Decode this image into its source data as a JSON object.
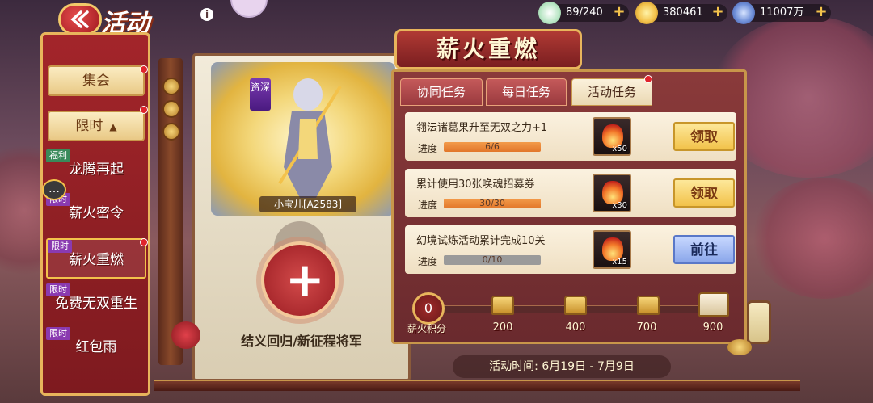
{
  "header": {
    "title": "活动",
    "info_glyph": "i",
    "resources": [
      {
        "icon": "stamina-bun-icon",
        "value": "89/240"
      },
      {
        "icon": "gold-ingot-icon",
        "value": "380461"
      },
      {
        "icon": "coin-icon",
        "value": "11007万"
      }
    ],
    "plus_glyph": "+"
  },
  "sidebar": {
    "collect_label": "集会",
    "limited_label": "限时",
    "caret": "▲",
    "items": [
      {
        "tag": "福利",
        "label": "龙腾再起"
      },
      {
        "tag": "限时",
        "label": "薪火密令"
      },
      {
        "tag": "限时",
        "label": "薪火重燃"
      },
      {
        "tag": "限时",
        "label": "免费无双重生"
      },
      {
        "tag": "限时",
        "label": "红包雨"
      }
    ]
  },
  "hero": {
    "tag": "资深",
    "name": "小宝儿[A2583]",
    "slot_plus": "+",
    "slot_caption": "结义回归/新征程将军"
  },
  "event": {
    "title": "薪火重燃",
    "tabs": [
      {
        "label": "协同任务"
      },
      {
        "label": "每日任务"
      },
      {
        "label": "活动任务"
      }
    ],
    "progress_label": "进度",
    "tasks": [
      {
        "title": "翎沄诸葛果升至无双之力+1",
        "progress_text": "6/6",
        "progress": 1.0,
        "reward_count": "x50",
        "action": "领取",
        "action_type": "claim"
      },
      {
        "title": "累计使用30张唤魂招募券",
        "progress_text": "30/30",
        "progress": 1.0,
        "reward_count": "x30",
        "action": "领取",
        "action_type": "claim"
      },
      {
        "title": "幻境试炼活动累计完成10关",
        "progress_text": "0/10",
        "progress": 0.0,
        "reward_count": "x15",
        "action": "前往",
        "action_type": "go"
      }
    ],
    "score": {
      "value": "0",
      "label": "薪火积分"
    },
    "milestones": [
      "200",
      "400",
      "700",
      "900"
    ],
    "time_label": "活动时间: 6月19日 - 7月9日"
  },
  "colors": {
    "accent_gold": "#e8b55c",
    "panel_red": "#8a3a3a",
    "progress_orange": "#e2762a",
    "claim_yellow": "#f2c24a",
    "go_blue": "#8aa6ea"
  }
}
